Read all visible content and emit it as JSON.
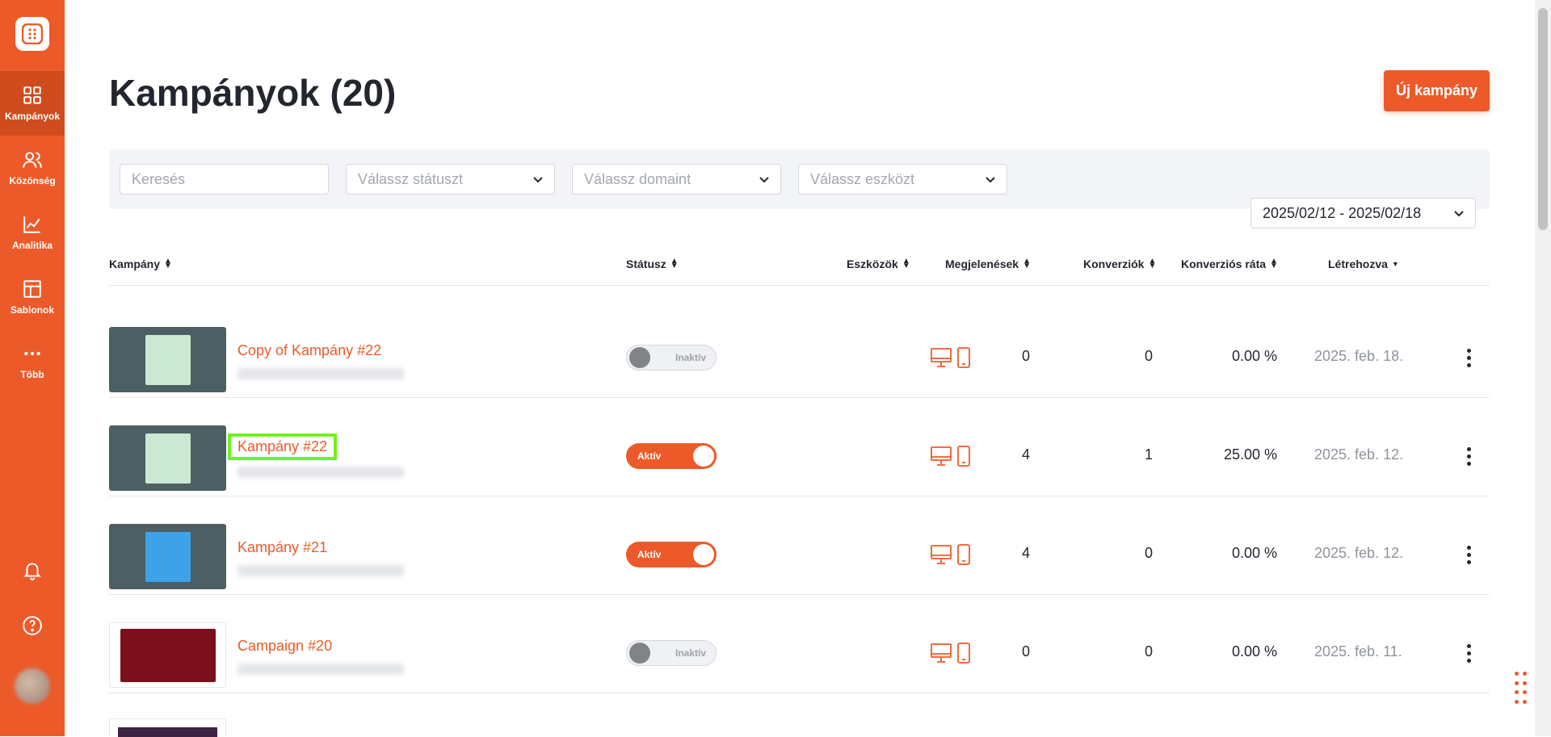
{
  "sidebar": {
    "items": [
      {
        "label": "Kampányok",
        "icon": "grid-icon",
        "active": true
      },
      {
        "label": "Közönség",
        "icon": "users-icon",
        "active": false
      },
      {
        "label": "Analitika",
        "icon": "chart-line-icon",
        "active": false
      },
      {
        "label": "Sablonok",
        "icon": "layout-icon",
        "active": false
      },
      {
        "label": "Több",
        "icon": "more-horizontal-icon",
        "active": false
      }
    ],
    "bottom_icons": [
      "bell-icon",
      "help-icon",
      "avatar"
    ]
  },
  "header": {
    "title": "Kampányok (20)",
    "new_button": "Új kampány"
  },
  "filters": {
    "search_placeholder": "Keresés",
    "status_placeholder": "Válassz státuszt",
    "domain_placeholder": "Válassz domaint",
    "device_placeholder": "Válassz eszközt",
    "date_range": "2025/02/12 - 2025/02/18"
  },
  "table": {
    "columns": {
      "campaign": "Kampány",
      "status": "Státusz",
      "devices": "Eszközök",
      "impressions": "Megjelenések",
      "conversions": "Konverziók",
      "conversion_rate": "Konverziós ráta",
      "created": "Létrehozva"
    },
    "rows": [
      {
        "name": "Copy of Kampány #22",
        "status": "Inaktív",
        "active": false,
        "impressions": "0",
        "conversions": "0",
        "rate": "0.00 %",
        "created": "2025. feb. 18.",
        "highlighted": false
      },
      {
        "name": "Kampány #22",
        "status": "Aktív",
        "active": true,
        "impressions": "4",
        "conversions": "1",
        "rate": "25.00 %",
        "created": "2025. feb. 12.",
        "highlighted": true
      },
      {
        "name": "Kampány #21",
        "status": "Aktív",
        "active": true,
        "impressions": "4",
        "conversions": "0",
        "rate": "0.00 %",
        "created": "2025. feb. 12.",
        "highlighted": false
      },
      {
        "name": "Campaign #20",
        "status": "Inaktív",
        "active": false,
        "impressions": "0",
        "conversions": "0",
        "rate": "0.00 %",
        "created": "2025. feb. 11.",
        "highlighted": false
      }
    ]
  },
  "colors": {
    "brand": "#ed5a29",
    "highlight": "#6ff21f",
    "text": "#23262f",
    "muted": "#8f939c"
  }
}
